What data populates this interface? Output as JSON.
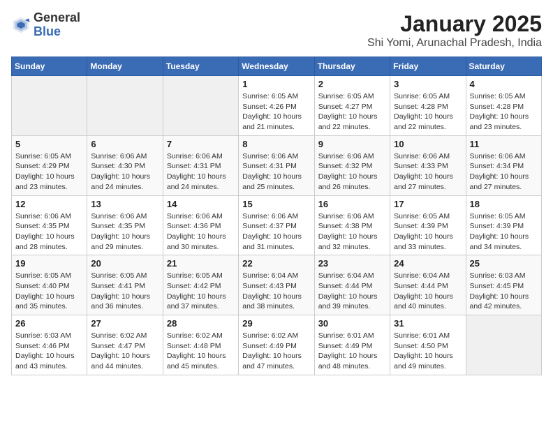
{
  "header": {
    "logo_general": "General",
    "logo_blue": "Blue",
    "title": "January 2025",
    "subtitle": "Shi Yomi, Arunachal Pradesh, India"
  },
  "calendar": {
    "weekdays": [
      "Sunday",
      "Monday",
      "Tuesday",
      "Wednesday",
      "Thursday",
      "Friday",
      "Saturday"
    ],
    "weeks": [
      [
        {
          "day": "",
          "detail": ""
        },
        {
          "day": "",
          "detail": ""
        },
        {
          "day": "",
          "detail": ""
        },
        {
          "day": "1",
          "detail": "Sunrise: 6:05 AM\nSunset: 4:26 PM\nDaylight: 10 hours\nand 21 minutes."
        },
        {
          "day": "2",
          "detail": "Sunrise: 6:05 AM\nSunset: 4:27 PM\nDaylight: 10 hours\nand 22 minutes."
        },
        {
          "day": "3",
          "detail": "Sunrise: 6:05 AM\nSunset: 4:28 PM\nDaylight: 10 hours\nand 22 minutes."
        },
        {
          "day": "4",
          "detail": "Sunrise: 6:05 AM\nSunset: 4:28 PM\nDaylight: 10 hours\nand 23 minutes."
        }
      ],
      [
        {
          "day": "5",
          "detail": "Sunrise: 6:05 AM\nSunset: 4:29 PM\nDaylight: 10 hours\nand 23 minutes."
        },
        {
          "day": "6",
          "detail": "Sunrise: 6:06 AM\nSunset: 4:30 PM\nDaylight: 10 hours\nand 24 minutes."
        },
        {
          "day": "7",
          "detail": "Sunrise: 6:06 AM\nSunset: 4:31 PM\nDaylight: 10 hours\nand 24 minutes."
        },
        {
          "day": "8",
          "detail": "Sunrise: 6:06 AM\nSunset: 4:31 PM\nDaylight: 10 hours\nand 25 minutes."
        },
        {
          "day": "9",
          "detail": "Sunrise: 6:06 AM\nSunset: 4:32 PM\nDaylight: 10 hours\nand 26 minutes."
        },
        {
          "day": "10",
          "detail": "Sunrise: 6:06 AM\nSunset: 4:33 PM\nDaylight: 10 hours\nand 27 minutes."
        },
        {
          "day": "11",
          "detail": "Sunrise: 6:06 AM\nSunset: 4:34 PM\nDaylight: 10 hours\nand 27 minutes."
        }
      ],
      [
        {
          "day": "12",
          "detail": "Sunrise: 6:06 AM\nSunset: 4:35 PM\nDaylight: 10 hours\nand 28 minutes."
        },
        {
          "day": "13",
          "detail": "Sunrise: 6:06 AM\nSunset: 4:35 PM\nDaylight: 10 hours\nand 29 minutes."
        },
        {
          "day": "14",
          "detail": "Sunrise: 6:06 AM\nSunset: 4:36 PM\nDaylight: 10 hours\nand 30 minutes."
        },
        {
          "day": "15",
          "detail": "Sunrise: 6:06 AM\nSunset: 4:37 PM\nDaylight: 10 hours\nand 31 minutes."
        },
        {
          "day": "16",
          "detail": "Sunrise: 6:06 AM\nSunset: 4:38 PM\nDaylight: 10 hours\nand 32 minutes."
        },
        {
          "day": "17",
          "detail": "Sunrise: 6:05 AM\nSunset: 4:39 PM\nDaylight: 10 hours\nand 33 minutes."
        },
        {
          "day": "18",
          "detail": "Sunrise: 6:05 AM\nSunset: 4:39 PM\nDaylight: 10 hours\nand 34 minutes."
        }
      ],
      [
        {
          "day": "19",
          "detail": "Sunrise: 6:05 AM\nSunset: 4:40 PM\nDaylight: 10 hours\nand 35 minutes."
        },
        {
          "day": "20",
          "detail": "Sunrise: 6:05 AM\nSunset: 4:41 PM\nDaylight: 10 hours\nand 36 minutes."
        },
        {
          "day": "21",
          "detail": "Sunrise: 6:05 AM\nSunset: 4:42 PM\nDaylight: 10 hours\nand 37 minutes."
        },
        {
          "day": "22",
          "detail": "Sunrise: 6:04 AM\nSunset: 4:43 PM\nDaylight: 10 hours\nand 38 minutes."
        },
        {
          "day": "23",
          "detail": "Sunrise: 6:04 AM\nSunset: 4:44 PM\nDaylight: 10 hours\nand 39 minutes."
        },
        {
          "day": "24",
          "detail": "Sunrise: 6:04 AM\nSunset: 4:44 PM\nDaylight: 10 hours\nand 40 minutes."
        },
        {
          "day": "25",
          "detail": "Sunrise: 6:03 AM\nSunset: 4:45 PM\nDaylight: 10 hours\nand 42 minutes."
        }
      ],
      [
        {
          "day": "26",
          "detail": "Sunrise: 6:03 AM\nSunset: 4:46 PM\nDaylight: 10 hours\nand 43 minutes."
        },
        {
          "day": "27",
          "detail": "Sunrise: 6:02 AM\nSunset: 4:47 PM\nDaylight: 10 hours\nand 44 minutes."
        },
        {
          "day": "28",
          "detail": "Sunrise: 6:02 AM\nSunset: 4:48 PM\nDaylight: 10 hours\nand 45 minutes."
        },
        {
          "day": "29",
          "detail": "Sunrise: 6:02 AM\nSunset: 4:49 PM\nDaylight: 10 hours\nand 47 minutes."
        },
        {
          "day": "30",
          "detail": "Sunrise: 6:01 AM\nSunset: 4:49 PM\nDaylight: 10 hours\nand 48 minutes."
        },
        {
          "day": "31",
          "detail": "Sunrise: 6:01 AM\nSunset: 4:50 PM\nDaylight: 10 hours\nand 49 minutes."
        },
        {
          "day": "",
          "detail": ""
        }
      ]
    ]
  }
}
